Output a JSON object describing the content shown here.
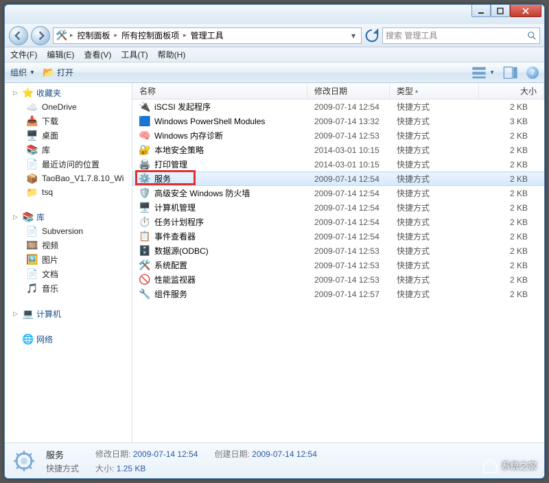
{
  "title_buttons": {
    "minimize": "–",
    "maximize": "□",
    "close": "✕"
  },
  "breadcrumb": [
    "控制面板",
    "所有控制面板项",
    "管理工具"
  ],
  "search_placeholder": "搜索 管理工具",
  "menu": {
    "file": "文件(F)",
    "edit": "编辑(E)",
    "view": "查看(V)",
    "tools": "工具(T)",
    "help": "帮助(H)"
  },
  "toolbar": {
    "organize": "组织",
    "open": "打开"
  },
  "columns": {
    "name": "名称",
    "date": "修改日期",
    "type": "类型",
    "size": "大小"
  },
  "sidebar": {
    "favorites": {
      "label": "收藏夹",
      "items": [
        {
          "icon": "cloud-icon",
          "label": "OneDrive"
        },
        {
          "icon": "download-icon",
          "label": "下载"
        },
        {
          "icon": "desktop-icon",
          "label": "桌面"
        },
        {
          "icon": "library-small-icon",
          "label": "库"
        },
        {
          "icon": "recent-icon",
          "label": "最近访问的位置"
        },
        {
          "icon": "archive-icon",
          "label": "TaoBao_V1.7.8.10_Wi"
        },
        {
          "icon": "folder-icon",
          "label": "tsq"
        }
      ]
    },
    "library": {
      "label": "库",
      "items": [
        {
          "icon": "svn-icon",
          "label": "Subversion"
        },
        {
          "icon": "video-icon",
          "label": "视频"
        },
        {
          "icon": "image-icon",
          "label": "图片"
        },
        {
          "icon": "document-icon",
          "label": "文档"
        },
        {
          "icon": "music-icon",
          "label": "音乐"
        }
      ]
    },
    "computer": {
      "label": "计算机"
    },
    "network": {
      "label": "网络"
    }
  },
  "files": [
    {
      "icon": "iscsi-icon",
      "name": "iSCSI 发起程序",
      "date": "2009-07-14 12:54",
      "type": "快捷方式",
      "size": "2 KB"
    },
    {
      "icon": "powershell-icon",
      "name": "Windows PowerShell Modules",
      "date": "2009-07-14 13:32",
      "type": "快捷方式",
      "size": "3 KB"
    },
    {
      "icon": "memdiag-icon",
      "name": "Windows 内存诊断",
      "date": "2009-07-14 12:53",
      "type": "快捷方式",
      "size": "2 KB"
    },
    {
      "icon": "secpol-icon",
      "name": "本地安全策略",
      "date": "2014-03-01 10:15",
      "type": "快捷方式",
      "size": "2 KB"
    },
    {
      "icon": "print-icon",
      "name": "打印管理",
      "date": "2014-03-01 10:15",
      "type": "快捷方式",
      "size": "2 KB"
    },
    {
      "icon": "services-icon",
      "name": "服务",
      "date": "2009-07-14 12:54",
      "type": "快捷方式",
      "size": "2 KB",
      "selected": true,
      "highlighted": true
    },
    {
      "icon": "firewall-icon",
      "name": "高级安全 Windows 防火墙",
      "date": "2009-07-14 12:54",
      "type": "快捷方式",
      "size": "2 KB"
    },
    {
      "icon": "compmgmt-icon",
      "name": "计算机管理",
      "date": "2009-07-14 12:54",
      "type": "快捷方式",
      "size": "2 KB"
    },
    {
      "icon": "task-icon",
      "name": "任务计划程序",
      "date": "2009-07-14 12:54",
      "type": "快捷方式",
      "size": "2 KB"
    },
    {
      "icon": "eventvwr-icon",
      "name": "事件查看器",
      "date": "2009-07-14 12:54",
      "type": "快捷方式",
      "size": "2 KB"
    },
    {
      "icon": "odbc-icon",
      "name": "数据源(ODBC)",
      "date": "2009-07-14 12:53",
      "type": "快捷方式",
      "size": "2 KB"
    },
    {
      "icon": "sysconfig-icon",
      "name": "系统配置",
      "date": "2009-07-14 12:53",
      "type": "快捷方式",
      "size": "2 KB"
    },
    {
      "icon": "perfmon-icon",
      "name": "性能监视器",
      "date": "2009-07-14 12:53",
      "type": "快捷方式",
      "size": "2 KB"
    },
    {
      "icon": "compsvc-icon",
      "name": "组件服务",
      "date": "2009-07-14 12:57",
      "type": "快捷方式",
      "size": "2 KB"
    }
  ],
  "details": {
    "name": "服务",
    "type": "快捷方式",
    "mod_label": "修改日期:",
    "mod_value": "2009-07-14 12:54",
    "size_label": "大小:",
    "size_value": "1.25 KB",
    "create_label": "创建日期:",
    "create_value": "2009-07-14 12:54"
  },
  "watermark": "系统之家"
}
